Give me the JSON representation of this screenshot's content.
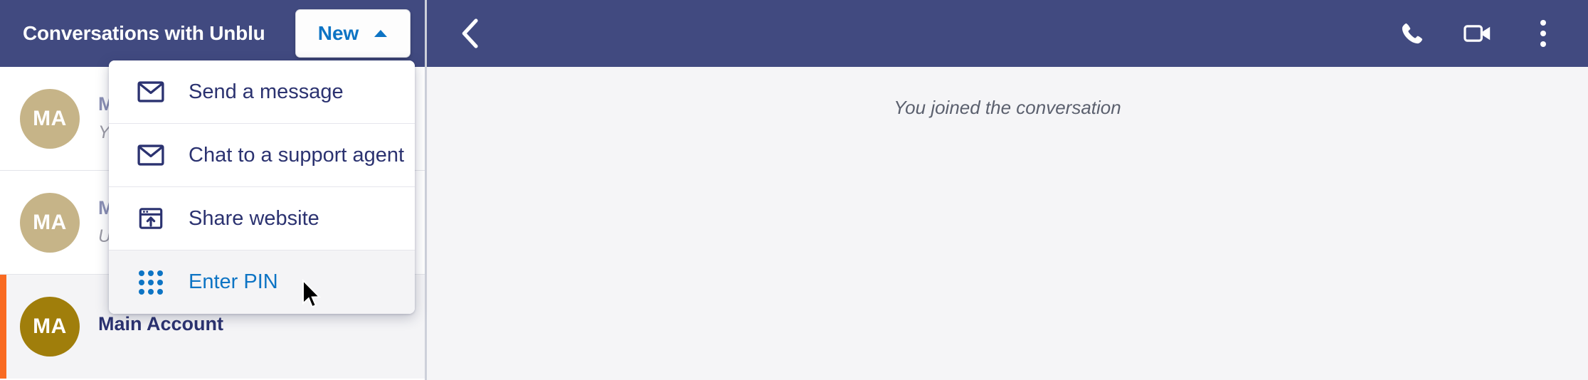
{
  "left_panel": {
    "title": "Conversations with Unblu",
    "new_button": {
      "label": "New",
      "caret_icon": "caret-up-icon"
    },
    "conversations": [
      {
        "avatar_initials": "MA",
        "name": "Ma",
        "preview": "Yo",
        "active": false
      },
      {
        "avatar_initials": "MA",
        "name": "Ma",
        "preview": "Un",
        "active": false
      },
      {
        "avatar_initials": "MA",
        "name": "Main Account",
        "preview": "",
        "active": true
      }
    ]
  },
  "dropdown": {
    "items": [
      {
        "label": "Send a message",
        "icon": "envelope-icon",
        "hovered": false
      },
      {
        "label": "Chat to a support agent",
        "icon": "envelope-icon",
        "hovered": false
      },
      {
        "label": "Share website",
        "icon": "share-window-icon",
        "hovered": false
      },
      {
        "label": "Enter PIN",
        "icon": "keypad-dots-icon",
        "hovered": true
      }
    ]
  },
  "right_panel": {
    "back_icon": "chevron-left-icon",
    "actions": [
      {
        "icon": "phone-icon",
        "name": "audio-call-button"
      },
      {
        "icon": "video-camera-icon",
        "name": "video-call-button"
      },
      {
        "icon": "more-vertical-icon",
        "name": "more-options-button"
      }
    ],
    "system_message": "You joined the conversation"
  },
  "colors": {
    "header_navy": "#414a80",
    "accent_blue": "#0d74c4",
    "menu_navy": "#2b3270",
    "active_orange": "#f96a21",
    "avatar_tan": "#c6b488",
    "avatar_gold": "#a07e0b",
    "chat_background": "#f5f5f7"
  }
}
